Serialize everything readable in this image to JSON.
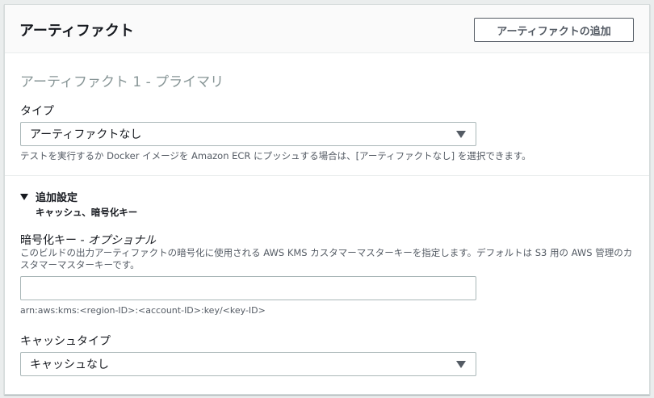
{
  "header": {
    "title": "アーティファクト",
    "add_button_label": "アーティファクトの追加"
  },
  "section": {
    "title": "アーティファクト 1 - プライマリ"
  },
  "type_field": {
    "label": "タイプ",
    "selected": "アーティファクトなし",
    "hint": "テストを実行するか Docker イメージを Amazon ECR にプッシュする場合は、[アーティファクトなし] を選択できます。"
  },
  "additional_settings": {
    "label": "追加設定",
    "subtitle": "キャッシュ、暗号化キー",
    "expanded": true
  },
  "encryption_key": {
    "label": "暗号化キー",
    "optional_label": " - オプショナル",
    "description": "このビルドの出力アーティファクトの暗号化に使用される AWS KMS カスタマーマスターキーを指定します。デフォルトは S3 用の AWS 管理のカスタマーマスターキーです。",
    "value": "",
    "format_hint": "arn:aws:kms:<region-ID>:<account-ID>:key/<key-ID>"
  },
  "cache_type": {
    "label": "キャッシュタイプ",
    "selected": "キャッシュなし"
  },
  "colors": {
    "background": "#eaeded",
    "panel": "#ffffff",
    "muted_text": "#879596",
    "border": "#aab7b8"
  }
}
